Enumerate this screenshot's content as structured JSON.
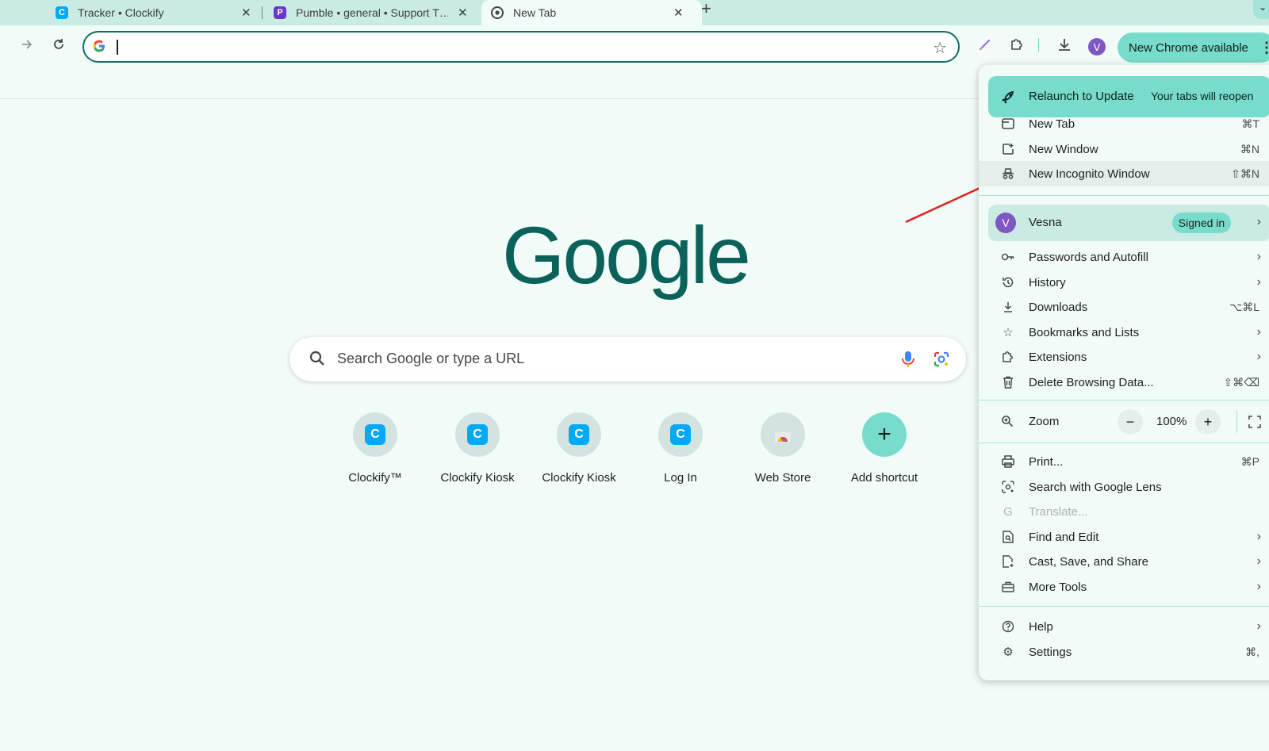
{
  "tabs": [
    {
      "title": "Tracker • Clockify",
      "icon": "clockify-icon",
      "close": "✕"
    },
    {
      "title": "Pumble • general • Support T…",
      "icon": "pumble-icon",
      "close": "✕"
    },
    {
      "title": "New Tab",
      "icon": "chrome-icon",
      "close": "✕"
    }
  ],
  "new_tab_symbol": "+",
  "omnibox": {
    "value": "",
    "placeholder": ""
  },
  "toolbar": {
    "avatar_letter": "V",
    "update_button": "New Chrome available",
    "menu_symbol": "⋮"
  },
  "ntp": {
    "logo": "Google",
    "search_placeholder": "Search Google or type a URL",
    "shortcuts": [
      {
        "label": "Clockify™",
        "icon": "clockify-icon"
      },
      {
        "label": "Clockify Kiosk",
        "icon": "clockify-icon"
      },
      {
        "label": "Clockify Kiosk",
        "icon": "clockify-icon"
      },
      {
        "label": "Log In",
        "icon": "clockify-icon"
      },
      {
        "label": "Web Store",
        "icon": "webstore-icon"
      },
      {
        "label": "Add shortcut",
        "icon": "plus-icon"
      }
    ]
  },
  "menu": {
    "relaunch": {
      "label": "Relaunch to Update",
      "subtitle": "Your tabs will reopen"
    },
    "group1": [
      {
        "label": "New Tab",
        "shortcut": "⌘T"
      },
      {
        "label": "New Window",
        "shortcut": "⌘N"
      },
      {
        "label": "New Incognito Window",
        "shortcut": "⇧⌘N"
      }
    ],
    "profile": {
      "avatar": "V",
      "name": "Vesna",
      "badge": "Signed in"
    },
    "group2": [
      {
        "label": "Passwords and Autofill",
        "shortcut": ""
      },
      {
        "label": "History",
        "shortcut": ""
      },
      {
        "label": "Downloads",
        "shortcut": "⌥⌘L"
      },
      {
        "label": "Bookmarks and Lists",
        "shortcut": ""
      },
      {
        "label": "Extensions",
        "shortcut": ""
      },
      {
        "label": "Delete Browsing Data...",
        "shortcut": "⇧⌘⌫"
      }
    ],
    "zoom": {
      "label": "Zoom",
      "minus": "−",
      "value": "100%",
      "plus": "+"
    },
    "group3": [
      {
        "label": "Print...",
        "shortcut": "⌘P"
      },
      {
        "label": "Search with Google Lens",
        "shortcut": ""
      },
      {
        "label": "Translate...",
        "shortcut": ""
      },
      {
        "label": "Find and Edit",
        "shortcut": ""
      },
      {
        "label": "Cast, Save, and Share",
        "shortcut": ""
      },
      {
        "label": "More Tools",
        "shortcut": ""
      }
    ],
    "group4": [
      {
        "label": "Help",
        "shortcut": ""
      },
      {
        "label": "Settings",
        "shortcut": "⌘,"
      }
    ],
    "chevron": "›"
  },
  "colors": {
    "accent": "#78dccc",
    "frame": "#c9ebe3",
    "logo": "#0b625a",
    "arrow": "#e02020"
  }
}
